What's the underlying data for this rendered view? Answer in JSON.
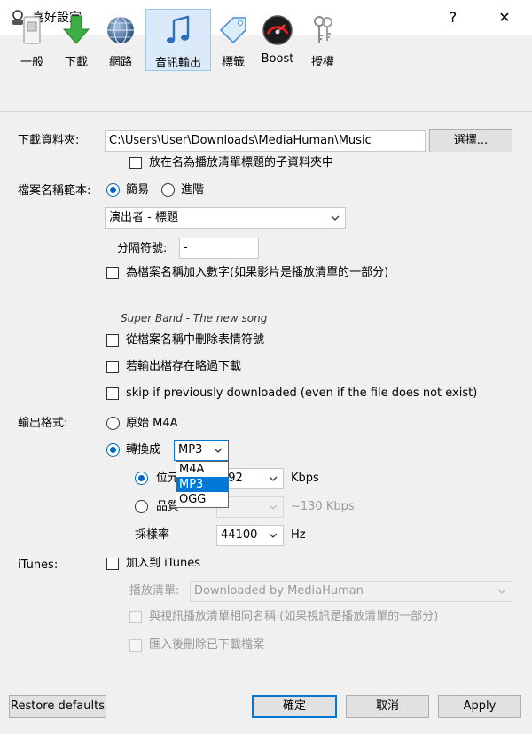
{
  "window": {
    "title": "喜好設定",
    "help": "?",
    "close": "✕"
  },
  "toolbar": {
    "items": [
      {
        "label": "一般",
        "icon": "switch-icon"
      },
      {
        "label": "下載",
        "icon": "download-arrow-icon"
      },
      {
        "label": "網路",
        "icon": "globe-icon"
      },
      {
        "label": "音訊輸出",
        "icon": "music-note-icon",
        "active": true
      },
      {
        "label": "標籤",
        "icon": "tag-icon"
      },
      {
        "label": "Boost",
        "icon": "speedometer-icon"
      },
      {
        "label": "授權",
        "icon": "keys-icon"
      }
    ]
  },
  "download": {
    "label": "下載資料夾:",
    "path": "C:\\Users\\User\\Downloads\\MediaHuman\\Music",
    "browse": "選擇...",
    "subfolder": "放在名為播放清單標題的子資料夾中"
  },
  "filename": {
    "label": "檔案名稱範本:",
    "simple": "簡易",
    "advanced": "進階",
    "template": "演出者 - 標題",
    "separator_label": "分隔符號:",
    "separator": "-",
    "add_number": "為檔案名稱加入數字(如果影片是播放清單的一部分)",
    "preview": "Super Band - The new song",
    "remove_emoji": "從檔案名稱中刪除表情符號",
    "skip_exists": "若輸出檔存在略過下載",
    "skip_prev": "skip if previously downloaded (even if the file does not exist)"
  },
  "output": {
    "label": "輸出格式:",
    "original": "原始 M4A",
    "convert": "轉換成",
    "format": "MP3",
    "format_options": [
      "M4A",
      "MP3",
      "OGG"
    ],
    "bitrate_label": "位元",
    "bitrate": "192",
    "bitrate_partial": "92",
    "kbps": "Kbps",
    "quality_label": "品質",
    "quality_hint": "~130 Kbps",
    "samplerate_label": "採樣率",
    "samplerate": "44100",
    "hz": "Hz"
  },
  "itunes": {
    "label": "iTunes:",
    "add": "加入到 iTunes",
    "playlist_label": "播放清單:",
    "playlist": "Downloaded by MediaHuman",
    "same_name": "與視訊播放清單相同名稱 (如果視訊是播放清單的一部分)",
    "delete_after": "匯入後刪除已下載檔案"
  },
  "footer": {
    "restore": "Restore defaults",
    "ok": "確定",
    "cancel": "取消",
    "apply": "Apply"
  },
  "colors": {
    "accent": "#0078d7",
    "selection": "#0078d7"
  }
}
